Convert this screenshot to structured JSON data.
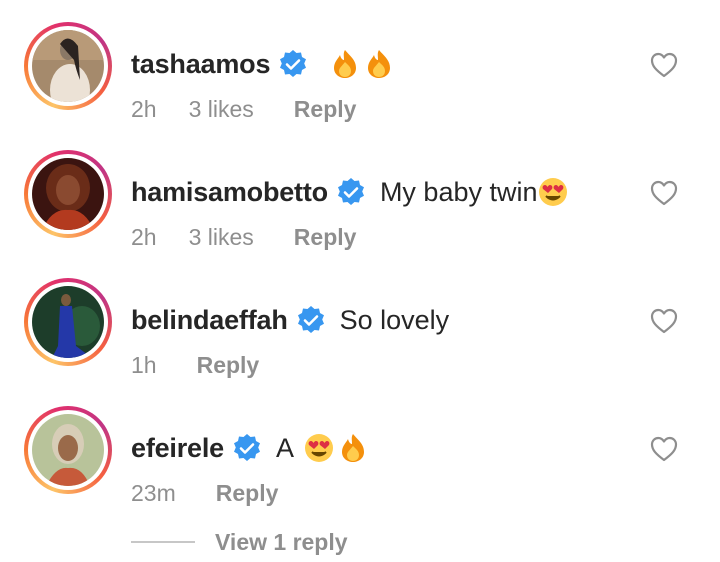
{
  "comments": [
    {
      "username": "tashaamos",
      "verified": true,
      "text": "",
      "emojis": [
        "fire-emoji",
        "fire-emoji"
      ],
      "time": "2h",
      "likes": "3 likes",
      "reply_label": "Reply",
      "avatar_colors": [
        "#a58a6c",
        "#ece2d6",
        "#8a7866"
      ]
    },
    {
      "username": "hamisamobetto",
      "verified": true,
      "text": "My baby twin",
      "emojis": [
        "heart-eyes-emoji"
      ],
      "time": "2h",
      "likes": "3 likes",
      "reply_label": "Reply",
      "avatar_colors": [
        "#3b1410",
        "#b33a1f",
        "#6a2c18"
      ]
    },
    {
      "username": "belindaeffah",
      "verified": true,
      "text": "So lovely",
      "emojis": [],
      "time": "1h",
      "likes": "",
      "reply_label": "Reply",
      "avatar_colors": [
        "#1d3d2a",
        "#2438a8",
        "#7a5a3d"
      ]
    },
    {
      "username": "efeirele",
      "verified": true,
      "text": "A",
      "emojis": [
        "heart-eyes-emoji",
        "fire-emoji"
      ],
      "time": "23m",
      "likes": "",
      "reply_label": "Reply",
      "avatar_colors": [
        "#b8c39a",
        "#d7cdb7",
        "#9a6a4a"
      ]
    }
  ],
  "view_replies_label": "View 1 reply",
  "colors": {
    "username": "#262626",
    "meta": "#8e8e8e",
    "verified": "#3897f0"
  }
}
